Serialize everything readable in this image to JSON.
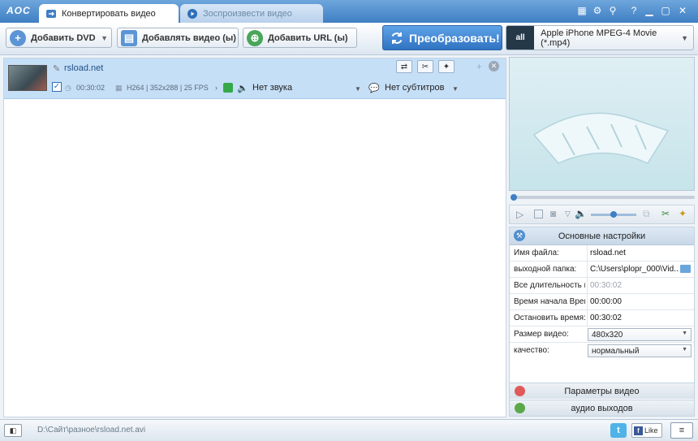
{
  "app": {
    "logo": "AOC",
    "tabs": [
      {
        "label": "Конвертировать видео"
      },
      {
        "label": "Зоспроизвести видео"
      }
    ]
  },
  "toolbar": {
    "add_dvd": "Добавить DVD",
    "add_video": "Добавлять видео (ы)",
    "add_url": "Добавить URL (ы)",
    "convert": "Преобразовать!",
    "profile": "Apple iPhone MPEG-4 Movie (*.mp4)",
    "profile_icon_text": "all"
  },
  "file": {
    "name": "rsload.net",
    "duration": "00:30:02",
    "info": "H264 | 352x288 | 25 FPS",
    "audio": "Нет звука",
    "subtitles": "Нет субтитров",
    "checked": true
  },
  "player": {
    "progress": 0,
    "volume": 0.6
  },
  "settings": {
    "title": "Основные настройки",
    "rows": [
      {
        "label": "Имя файла:",
        "value": "rsload.net"
      },
      {
        "label": "выходной папка:",
        "value": "C:\\Users\\plopr_000\\Vid..."
      },
      {
        "label": "Все длительность к",
        "value": "00:30:02"
      },
      {
        "label": "Время начала Врем",
        "value": "00:00:00"
      },
      {
        "label": "Остановить время:",
        "value": "00:30:02"
      }
    ],
    "video_size_label": "Размер видео:",
    "video_size": "480x320",
    "quality_label": "качество:",
    "quality": "нормальный",
    "video_params": "Параметры видео",
    "audio_output": "аудио выходов"
  },
  "status": {
    "path": "D:\\Сайт\\разное\\rsload.net.avi",
    "like": "Like"
  },
  "colors": {
    "accent": "#3f7fc3",
    "selected_row": "#c5dff7",
    "convert": "#2f73c2"
  }
}
